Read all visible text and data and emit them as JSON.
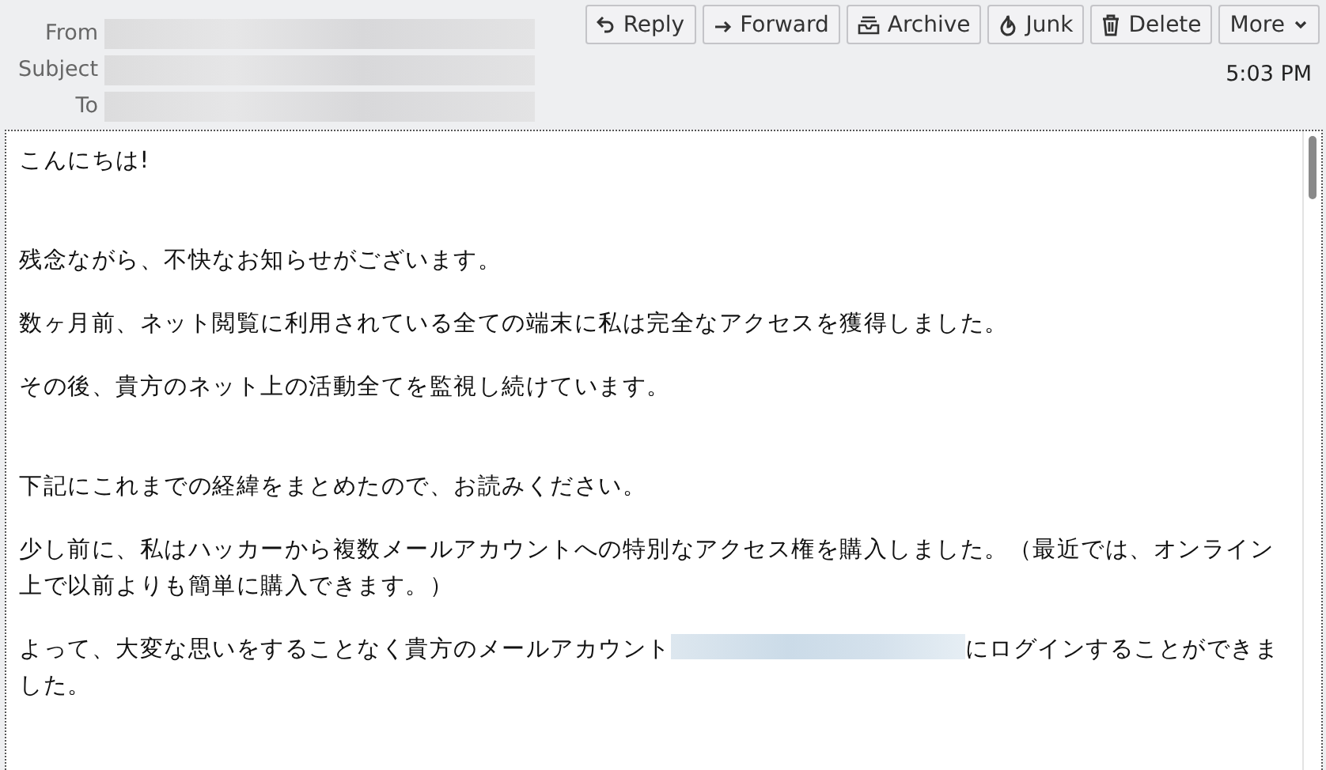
{
  "header": {
    "fields": [
      {
        "label": "From"
      },
      {
        "label": "Subject"
      },
      {
        "label": "To"
      }
    ],
    "buttons": [
      {
        "label": "Reply"
      },
      {
        "label": "Forward"
      },
      {
        "label": "Archive"
      },
      {
        "label": "Junk"
      },
      {
        "label": "Delete"
      },
      {
        "label": "More"
      }
    ],
    "time": "5:03 PM"
  },
  "body": {
    "sections": [
      {
        "paragraphs": [
          {
            "parts": [
              {
                "kind": "text",
                "text": "こんにちは!"
              }
            ]
          }
        ]
      },
      {
        "paragraphs": [
          {
            "parts": [
              {
                "kind": "text",
                "text": "残念ながら、不快なお知らせがございます。"
              }
            ]
          },
          {
            "parts": [
              {
                "kind": "text",
                "text": "数ヶ月前、ネット閲覧に利用されている全ての端末に私は完全なアクセスを獲得しました。"
              }
            ]
          },
          {
            "parts": [
              {
                "kind": "text",
                "text": "その後、貴方のネット上の活動全てを監視し続けています。"
              }
            ]
          }
        ]
      },
      {
        "paragraphs": [
          {
            "parts": [
              {
                "kind": "text",
                "text": "下記にこれまでの経緯をまとめたので、お読みください。"
              }
            ]
          },
          {
            "parts": [
              {
                "kind": "text",
                "text": "少し前に、私はハッカーから複数メールアカウントへの特別なアクセス権を購入しました。（最近では、オンライン上で以前よりも簡単に購入できます。）"
              }
            ]
          },
          {
            "parts": [
              {
                "kind": "text",
                "text": "よって、大変な思いをすることなく貴方のメールアカウント"
              },
              {
                "kind": "redacted"
              },
              {
                "kind": "text",
                "text": "にログインすることができました。"
              }
            ]
          }
        ]
      }
    ]
  }
}
